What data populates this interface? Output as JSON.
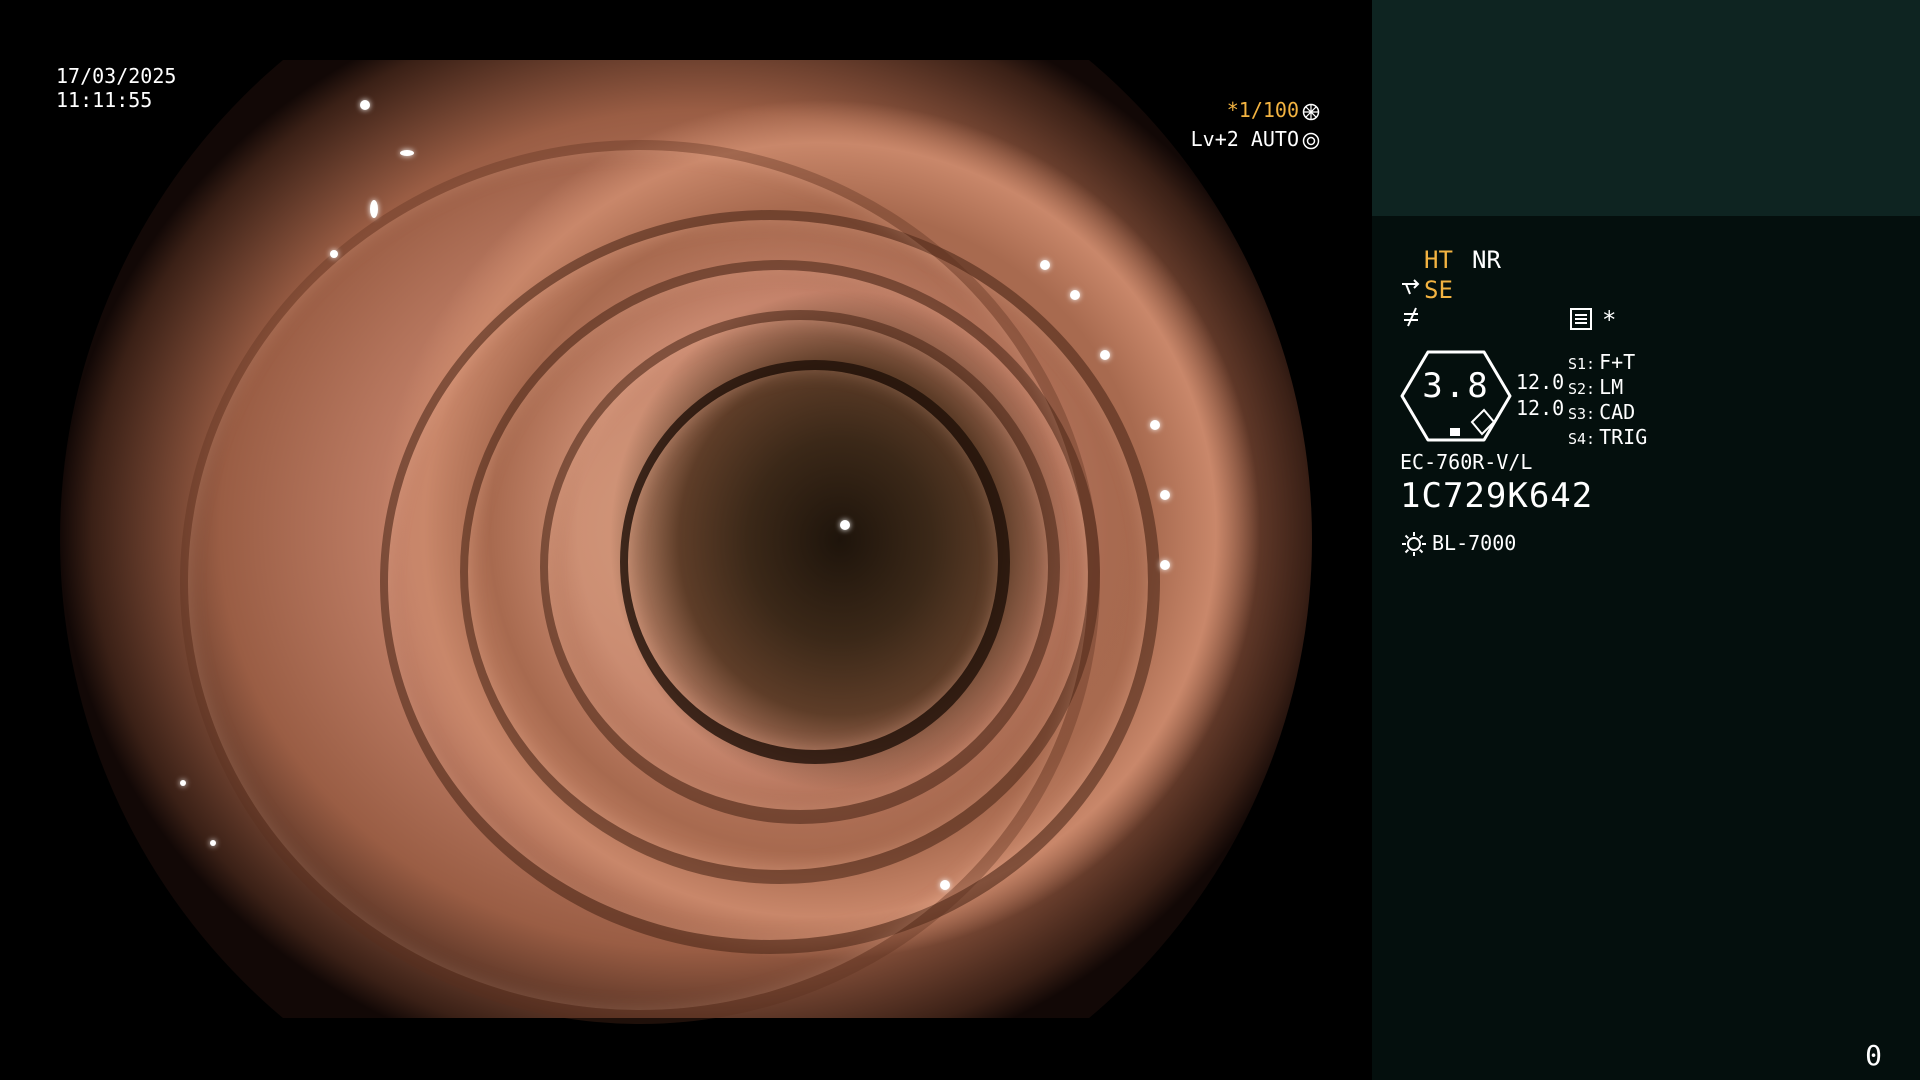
{
  "overlay": {
    "date": "17/03/2025",
    "time": "11:11:55",
    "shutter": "*1/100",
    "level": "Lv+2 AUTO"
  },
  "panel": {
    "ht_label": "HT",
    "nr_label": "NR",
    "se_label": "SE",
    "star_label": "*",
    "zoom_value": "3.8",
    "value_a": "12.0",
    "value_b": "12.0",
    "settings": [
      {
        "key": "S1:",
        "value": "F+T"
      },
      {
        "key": "S2:",
        "value": "LM"
      },
      {
        "key": "S3:",
        "value": "CAD"
      },
      {
        "key": "S4:",
        "value": "TRIG"
      }
    ],
    "scope_model": "EC-760R-V/L",
    "scope_serial": "1C729K642",
    "light_source": "BL-7000",
    "frame_counter": "0"
  },
  "colors": {
    "accent_amber": "#f3b341",
    "panel_bg": "#040f0d",
    "thumb_bg": "#0e2421"
  },
  "icons": [
    "aperture-icon",
    "iris-icon",
    "se-mode-icon",
    "slash-mode-icon",
    "menu-list-icon",
    "light-source-icon"
  ]
}
